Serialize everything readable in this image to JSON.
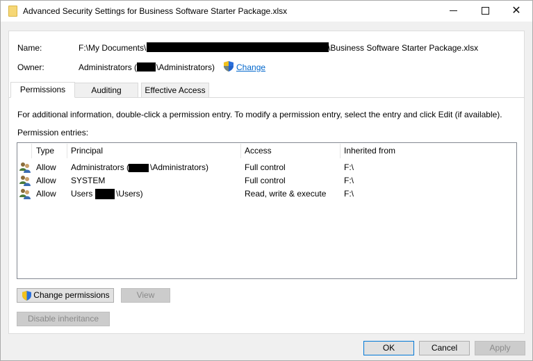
{
  "window": {
    "title": "Advanced Security Settings for Business Software Starter Package.xlsx"
  },
  "name_row": {
    "label": "Name:",
    "value_prefix": "F:\\My Documents\\",
    "value_suffix": "\\Business Software Starter Package.xlsx"
  },
  "owner_row": {
    "label": "Owner:",
    "value_prefix": "Administrators (",
    "value_suffix": "\\Administrators)",
    "change_label": "Change"
  },
  "tabs": [
    {
      "label": "Permissions",
      "active": true
    },
    {
      "label": "Auditing",
      "active": false
    },
    {
      "label": "Effective Access",
      "active": false
    }
  ],
  "info_text": "For additional information, double-click a permission entry. To modify a permission entry, select the entry and click Edit (if available).",
  "entries_label": "Permission entries:",
  "table": {
    "columns": [
      "Type",
      "Principal",
      "Access",
      "Inherited from"
    ],
    "rows": [
      {
        "type": "Allow",
        "principal_prefix": "Administrators (",
        "principal_suffix": "\\Administrators)",
        "access": "Full control",
        "inherited": "F:\\"
      },
      {
        "type": "Allow",
        "principal_prefix": "SYSTEM",
        "principal_suffix": "",
        "access": "Full control",
        "inherited": "F:\\"
      },
      {
        "type": "Allow",
        "principal_prefix": "Users (",
        "principal_suffix": "\\Users)",
        "access": "Read, write & execute",
        "inherited": "F:\\"
      }
    ]
  },
  "buttons": {
    "change_permissions": "Change permissions",
    "view": "View",
    "disable_inheritance": "Disable inheritance",
    "ok": "OK",
    "cancel": "Cancel",
    "apply": "Apply"
  },
  "colors": {
    "link": "#0066cc",
    "default_button_border": "#0078d7"
  }
}
